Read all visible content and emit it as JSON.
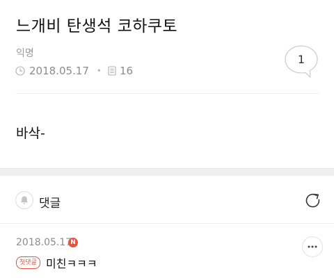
{
  "post": {
    "title": "느개비 탄생석 코하쿠토",
    "author": "익명",
    "date": "2018.05.17",
    "view_count": "16",
    "comment_count": "1",
    "body": "바삭-"
  },
  "comments_section": {
    "title": "댓글",
    "items": [
      {
        "date": "2018.05.17",
        "new_badge": "N",
        "first_badge": "첫댓글",
        "text": "미친ㅋㅋㅋ"
      }
    ]
  },
  "colors": {
    "accent_red": "#e8513c",
    "meta_gray": "#8c8c8c",
    "divider": "#ececec",
    "section_bg": "#f0f0f2"
  },
  "icons": {
    "clock": "clock-icon",
    "document": "document-icon",
    "speech_bubble": "speech-bubble-icon",
    "bell": "bell-icon",
    "refresh": "refresh-icon",
    "more": "more-horizontal-icon"
  }
}
